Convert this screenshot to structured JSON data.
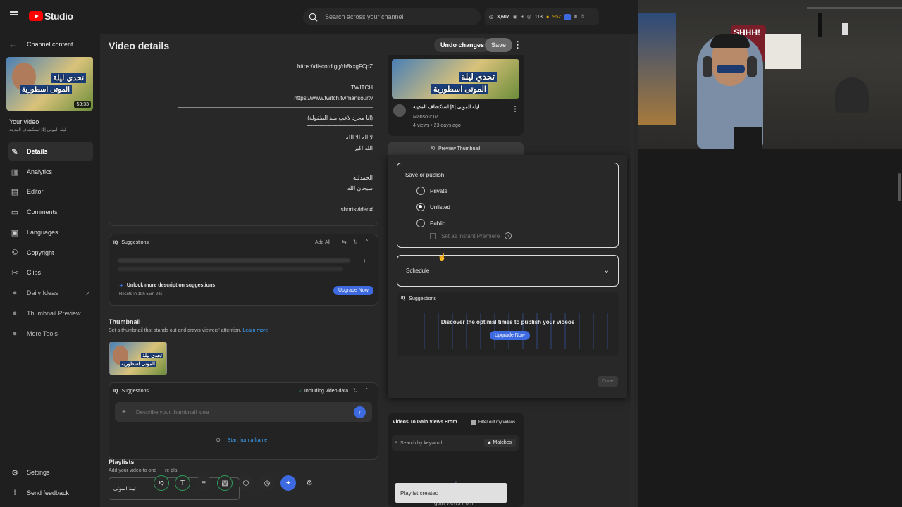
{
  "topbar": {
    "app_name": "Studio",
    "search_placeholder": "Search across your channel",
    "stats": [
      "3,607",
      "9",
      "113",
      "952"
    ]
  },
  "sidebar": {
    "back_label": "Channel content",
    "video_duration": "53:33",
    "your_video_label": "Your video",
    "video_title": "ليلة الموتى |1| استكشاف المدينة",
    "items": [
      {
        "label": "Details",
        "icon": "pencil-icon"
      },
      {
        "label": "Analytics",
        "icon": "chart-icon"
      },
      {
        "label": "Editor",
        "icon": "film-icon"
      },
      {
        "label": "Comments",
        "icon": "comment-icon"
      },
      {
        "label": "Languages",
        "icon": "subtitles-icon"
      },
      {
        "label": "Copyright",
        "icon": "copyright-icon"
      },
      {
        "label": "Clips",
        "icon": "scissors-icon"
      },
      {
        "label": "Daily Ideas",
        "icon": "bulb-icon"
      },
      {
        "label": "Thumbnail Preview",
        "icon": "preview-icon"
      },
      {
        "label": "More Tools",
        "icon": "tools-icon"
      }
    ],
    "settings_label": "Settings",
    "feedback_label": "Send feedback"
  },
  "header": {
    "title": "Video details",
    "undo_label": "Undo changes",
    "save_label": "Save"
  },
  "description": {
    "lines": [
      "https://discord.gg/rh8xxgFCpZ",
      ":TWITCH",
      "_https://www.twitch.tv/mansourtv",
      "(انا مجرد لاعب منذ الطفولة)",
      "==========================",
      "لا اله الا الله",
      "الله اكبر",
      "الحمدلله",
      "سبحان الله",
      "shortsvideo#"
    ]
  },
  "desc_suggestions": {
    "title": "Suggestions",
    "add_all": "Add All",
    "unlock_text": "Unlock more description suggestions",
    "resets_text": "Resets in 19h 55m 24s",
    "upgrade_label": "Upgrade Now"
  },
  "thumbnail": {
    "title": "Thumbnail",
    "subtitle": "Set a thumbnail that stands out and draws viewers' attention.",
    "learn_more": "Learn more",
    "thumb_text_1": "تحدي ليلة",
    "thumb_text_2": "الموتى اسطورية",
    "suggestions_title": "Suggestions",
    "including_data": "Including video data",
    "input_placeholder": "Describe your thumbnail idea",
    "or_text": "Or",
    "start_from_frame": "Start from a frame"
  },
  "playlists": {
    "title": "Playlists",
    "subtitle_start": "Add your video to one",
    "subtitle_mid": "re pla",
    "value": "ليلة الموتى"
  },
  "preview_card": {
    "title": "ليلة الموتى |1| استكشاف المدينة",
    "channel": "MansourTv",
    "meta": "4 views • 23 days ago",
    "preview_button": "Preview Thumbnail"
  },
  "publish": {
    "title": "Save or publish",
    "options": [
      "Private",
      "Unlisted",
      "Public"
    ],
    "selected": "Unlisted",
    "premiere_label": "Set as instant Premiere",
    "schedule_label": "Schedule",
    "suggestions_title": "Suggestions",
    "discover_text": "Discover the optimal times to publish your videos",
    "upgrade_label": "Upgrade Now",
    "done_label": "Done"
  },
  "views_panel": {
    "title": "Videos To Gain Views From",
    "filter_label": "Filter out my videos",
    "search_placeholder": "Search by keyword",
    "matches_label": "Matches",
    "bottom_text": "gain views from"
  },
  "toast": {
    "text": "Playlist created"
  },
  "webcam": {
    "sign_text": "SHHH!"
  },
  "colors": {
    "accent": "#3e6ae1",
    "brand_red": "#ff0000",
    "green_ring": "#2e9e5b"
  }
}
